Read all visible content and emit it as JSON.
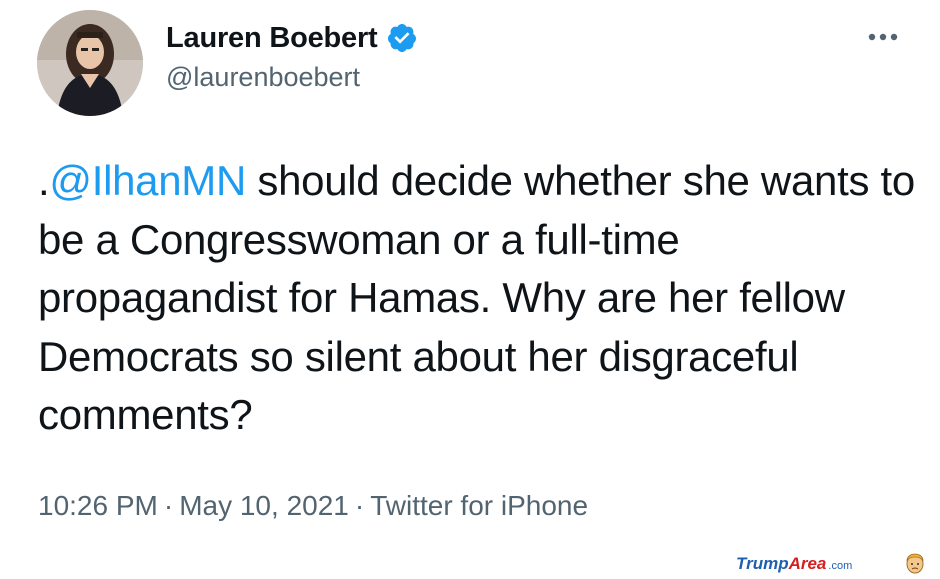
{
  "tweet": {
    "author": {
      "name": "Lauren Boebert",
      "handle": "@laurenboebert",
      "verified": true
    },
    "text": {
      "prefix": ".",
      "mention": "@IlhanMN",
      "body": " should decide whether she wants to be a Congresswoman or a full-time propagandist for Hamas. Why are her fellow Democrats so silent about her disgraceful comments?"
    },
    "meta": {
      "time": "10:26 PM",
      "separator": "·",
      "date": "May 10, 2021",
      "source": "Twitter for iPhone"
    }
  },
  "watermark": {
    "part1": "Trump",
    "part2": "Area",
    "suffix": ".com"
  },
  "colors": {
    "accent": "#1d9bf0",
    "secondary_text": "#536471",
    "primary_text": "#0f1419",
    "watermark_blue": "#1d5fb0",
    "watermark_red": "#d32020"
  },
  "icons": [
    "verified-badge-icon",
    "more-options-icon",
    "watermark-face-icon"
  ]
}
